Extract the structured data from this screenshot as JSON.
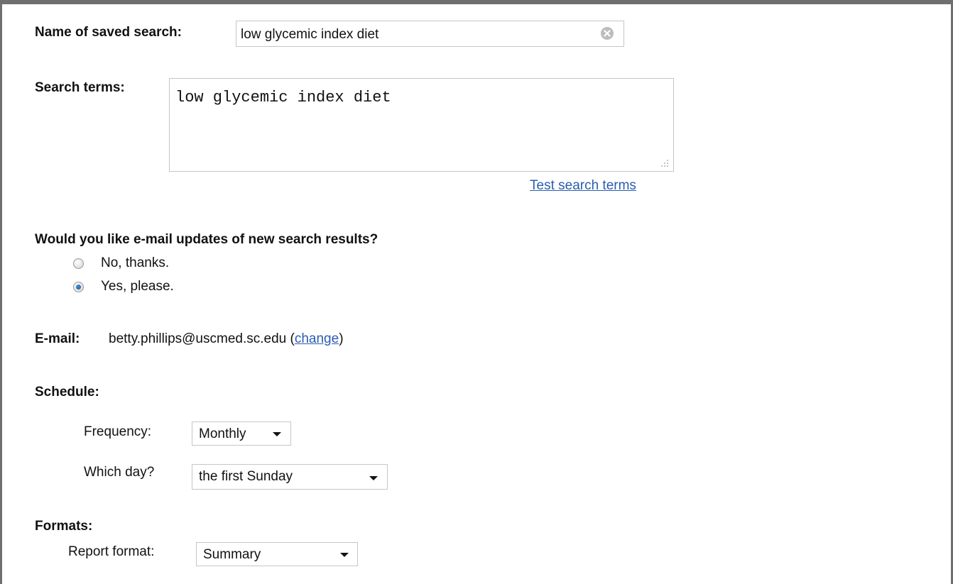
{
  "saved_search": {
    "name_label": "Name of saved search:",
    "name_value": "low glycemic index diet"
  },
  "search_terms": {
    "label": "Search terms:",
    "value": "low glycemic index diet",
    "test_link": "Test search terms"
  },
  "email_updates": {
    "question": "Would you like e-mail updates of new search results?",
    "options": [
      {
        "label": "No, thanks.",
        "selected": false
      },
      {
        "label": "Yes, please.",
        "selected": true
      }
    ]
  },
  "email": {
    "label": "E-mail:",
    "address": "betty.phillips@uscmed.sc.edu",
    "open_paren": "(",
    "change_link": "change",
    "close_paren": ")"
  },
  "schedule": {
    "heading": "Schedule:",
    "frequency_label": "Frequency:",
    "frequency_value": "Monthly",
    "day_label": "Which day?",
    "day_value": "the first Sunday"
  },
  "formats": {
    "heading": "Formats:",
    "report_label": "Report format:",
    "report_value": "Summary"
  },
  "colors": {
    "frame": "#6f6f6f",
    "link": "#2a5db0",
    "input_border": "#c6c6c6"
  }
}
